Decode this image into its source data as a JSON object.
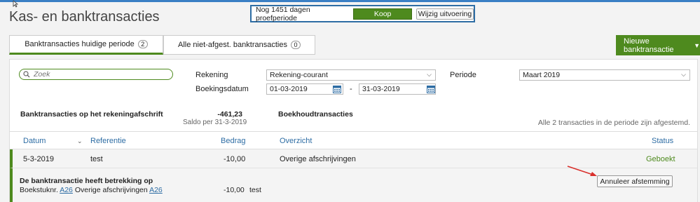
{
  "page": {
    "title": "Kas- en banktransacties"
  },
  "trial": {
    "text": "Nog 1451 dagen proefperiode",
    "buy_label": "Koop",
    "change_label": "Wijzig uitvoering"
  },
  "tabs": [
    {
      "label": "Banktransacties huidige periode",
      "count": "2"
    },
    {
      "label": "Alle niet-afgest. banktransacties",
      "count": "0"
    }
  ],
  "new_button": {
    "label": "Nieuwe banktransactie"
  },
  "search": {
    "placeholder": "Zoek",
    "value": ""
  },
  "filters": {
    "rekening_label": "Rekening",
    "rekening_value": "Rekening-courant",
    "periode_label": "Periode",
    "periode_value": "Maart 2019",
    "boekingsdatum_label": "Boekingsdatum",
    "date_from": "01-03-2019",
    "date_separator": "-",
    "date_to": "31-03-2019"
  },
  "summary": {
    "bank_label": "Banktransacties op het rekeningafschrift",
    "bank_amount": "-461,23",
    "saldo_text": "Saldo per 31-3-2019",
    "boekhoud_label": "Boekhoudtransacties",
    "status_text": "Alle 2 transacties in de periode zijn afgestemd."
  },
  "table": {
    "headers": {
      "datum": "Datum",
      "referentie": "Referentie",
      "bedrag": "Bedrag",
      "overzicht": "Overzicht",
      "status": "Status"
    },
    "rows": [
      {
        "datum": "5-3-2019",
        "referentie": "test",
        "bedrag": "-10,00",
        "overzicht": "Overige afschrijvingen",
        "status": "Geboekt"
      }
    ]
  },
  "detail": {
    "title": "De banktransactie heeft betrekking op",
    "prefix": "Boekstuknr.",
    "link1": "A26",
    "middle": "Overige afschrijvingen",
    "link2": "A26",
    "amount": "-10,00",
    "description": "test",
    "cancel_label": "Annuleer afstemming"
  },
  "colors": {
    "accent_green": "#4e8a1e",
    "link_blue": "#2e6da4",
    "annotation_red": "#d9302c"
  },
  "icons": [
    "search-icon",
    "calendar-icon",
    "chevron-down-icon",
    "cursor-icon"
  ]
}
